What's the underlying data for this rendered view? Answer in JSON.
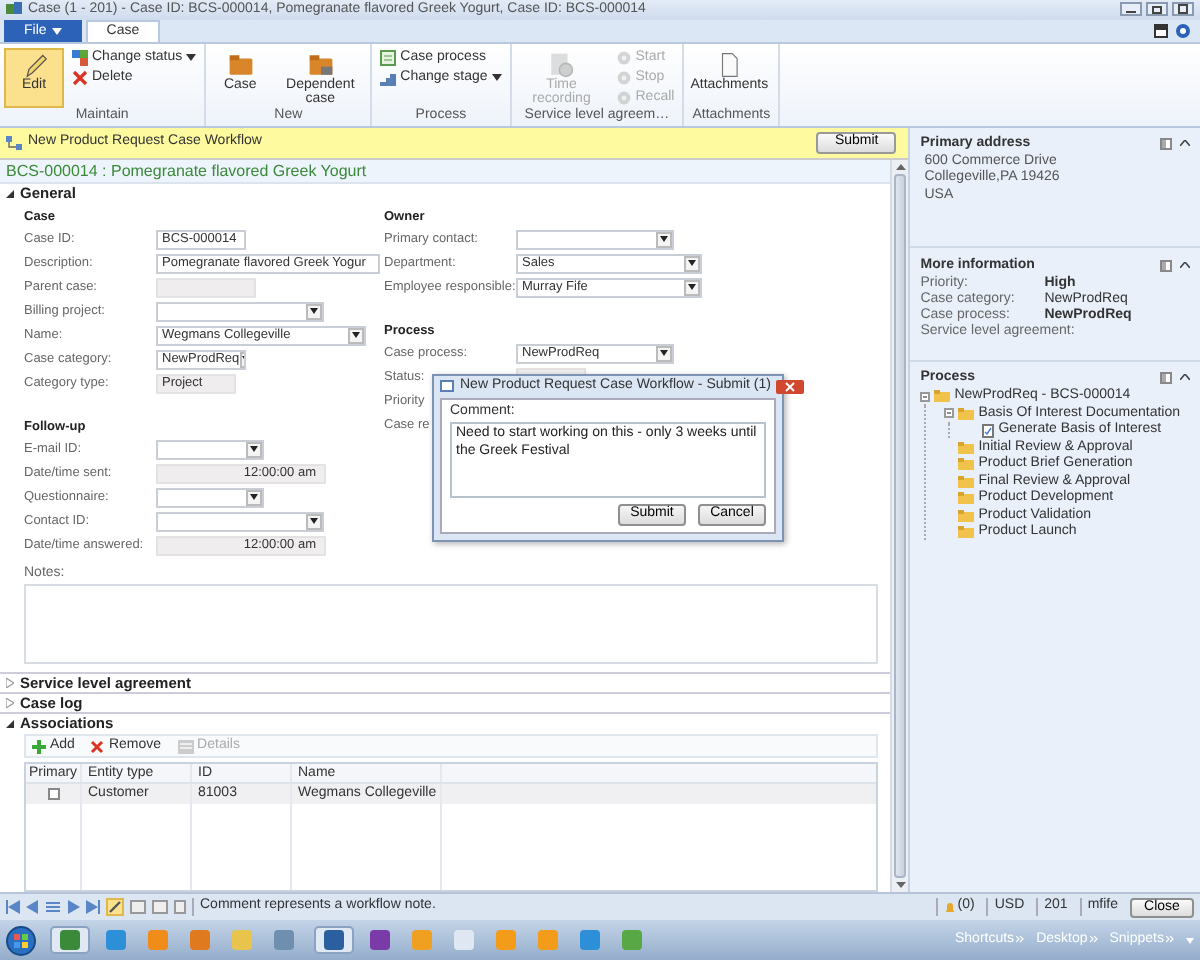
{
  "window": {
    "title": "Case (1 - 201) - Case ID: BCS-000014, Pomegranate flavored Greek Yogurt, Case ID: BCS-000014"
  },
  "tabs": [
    {
      "label": "File",
      "kind": "menu",
      "selected": false
    },
    {
      "label": "Case",
      "kind": "tab",
      "selected": true
    }
  ],
  "ribbon": [
    {
      "label": "Maintain",
      "buttons": [
        {
          "label": "Edit",
          "kind": "large",
          "selected": true,
          "disabled": false,
          "dropdown": false
        },
        {
          "label": "Change status",
          "kind": "small",
          "selected": false,
          "disabled": false,
          "dropdown": true
        },
        {
          "label": "Delete",
          "kind": "small",
          "selected": false,
          "disabled": false,
          "dropdown": false
        }
      ]
    },
    {
      "label": "New",
      "buttons": [
        {
          "label": "Case",
          "kind": "large",
          "selected": false,
          "disabled": false,
          "dropdown": false
        },
        {
          "label": "Dependent case",
          "kind": "large",
          "selected": false,
          "disabled": false,
          "dropdown": false
        }
      ]
    },
    {
      "label": "Process",
      "buttons": [
        {
          "label": "Case process",
          "kind": "small",
          "selected": false,
          "disabled": false,
          "dropdown": false
        },
        {
          "label": "Change stage",
          "kind": "small",
          "selected": false,
          "disabled": false,
          "dropdown": true
        }
      ]
    },
    {
      "label": "Service level agreem…",
      "buttons": [
        {
          "label": "Time recording",
          "kind": "large",
          "selected": false,
          "disabled": true,
          "dropdown": false
        },
        {
          "label": "Start",
          "kind": "small",
          "selected": false,
          "disabled": true,
          "dropdown": false
        },
        {
          "label": "Stop",
          "kind": "small",
          "selected": false,
          "disabled": true,
          "dropdown": false
        },
        {
          "label": "Recall",
          "kind": "small",
          "selected": false,
          "disabled": true,
          "dropdown": false
        }
      ]
    },
    {
      "label": "Attachments",
      "buttons": [
        {
          "label": "Attachments",
          "kind": "large",
          "selected": false,
          "disabled": false,
          "dropdown": false
        }
      ]
    }
  ],
  "workflow": {
    "title": "New Product Request Case Workflow",
    "button": "Submit"
  },
  "record_title": "BCS-000014 : Pomegranate flavored Greek Yogurt",
  "sections": [
    {
      "title": "General",
      "expanded": true,
      "columns": [
        [
          {
            "heading": "Case",
            "fields": [
              {
                "label": "Case ID:",
                "kind": "text",
                "value": "BCS-000014"
              },
              {
                "label": "Description:",
                "kind": "text",
                "value": "Pomegranate flavored Greek Yogur"
              },
              {
                "label": "Parent case:",
                "kind": "readonly"
              },
              {
                "label": "Billing project:",
                "kind": "dropdown"
              },
              {
                "label": "Name:",
                "kind": "dropdown",
                "value": "Wegmans Collegeville"
              },
              {
                "label": "Case category:",
                "kind": "dropdown",
                "value": "NewProdReq"
              },
              {
                "label": "Category type:",
                "kind": "readonly",
                "value": "Project"
              }
            ]
          },
          {
            "heading": "Follow-up",
            "fields": [
              {
                "label": "E-mail ID:",
                "kind": "dropdown"
              },
              {
                "label": "Date/time sent:",
                "kind": "datetime",
                "value": "12:00:00 am"
              },
              {
                "label": "Questionnaire:",
                "kind": "dropdown"
              },
              {
                "label": "Contact ID:",
                "kind": "dropdown"
              },
              {
                "label": "Date/time answered:",
                "kind": "datetime",
                "value": "12:00:00 am"
              }
            ]
          }
        ],
        [
          {
            "heading": "Owner",
            "fields": [
              {
                "label": "Primary contact:",
                "kind": "dropdown"
              },
              {
                "label": "Department:",
                "kind": "dropdown",
                "value": "Sales"
              },
              {
                "label": "Employee responsible:",
                "kind": "dropdown",
                "value": "Murray Fife"
              }
            ]
          },
          {
            "heading": "Process",
            "fields": [
              {
                "label": "Case process:",
                "kind": "dropdown",
                "value": "NewProdReq"
              },
              {
                "label": "Status:",
                "kind": "readonly"
              },
              {
                "label": "Priority",
                "kind": "hidden"
              },
              {
                "label": "Case re",
                "kind": "hidden"
              }
            ]
          }
        ]
      ],
      "notes": "Notes:"
    },
    {
      "title": "Service level agreement",
      "expanded": false
    },
    {
      "title": "Case log",
      "expanded": false
    },
    {
      "title": "Associations",
      "expanded": true,
      "toolbar": [
        {
          "label": "Add",
          "disabled": false
        },
        {
          "label": "Remove",
          "disabled": false
        },
        {
          "label": "Details",
          "disabled": true
        }
      ],
      "table": {
        "columns": [
          "Primary",
          "Entity type",
          "ID",
          "Name"
        ],
        "rows": [
          {
            "cells": [
              {
                "kind": "checkbox",
                "checked": false
              },
              "Customer",
              "81003",
              "Wegmans Collegeville"
            ]
          }
        ]
      }
    }
  ],
  "dialog": {
    "title": "New Product Request Case Workflow - Submit (1)",
    "label": "Comment:",
    "value": "Need to start working on this - only 3 weeks until the Greek Festival",
    "buttons": [
      "Submit",
      "Cancel"
    ]
  },
  "side_panels": [
    {
      "title": "Primary address",
      "kind": "address",
      "lines": [
        "600 Commerce Drive",
        "Collegeville,PA 19426",
        "USA"
      ]
    },
    {
      "title": "More information",
      "kind": "info",
      "rows": [
        {
          "label": "Priority:",
          "value": "High",
          "emphasis": true
        },
        {
          "label": "Case category:",
          "value": "NewProdReq",
          "emphasis": false
        },
        {
          "label": "Case process:",
          "value": "NewProdReq",
          "emphasis": true
        },
        {
          "label": "Service level agreement:"
        }
      ]
    },
    {
      "title": "Process",
      "kind": "tree",
      "tree": [
        {
          "label": "NewProdReq - BCS-000014",
          "kind": "folder",
          "expanded": true,
          "children": [
            {
              "label": "Basis Of Interest Documentation",
              "kind": "folder",
              "expanded": true,
              "children": [
                {
                  "label": "Generate Basis of Interest",
                  "kind": "task"
                }
              ]
            },
            {
              "label": "Initial Review & Approval",
              "kind": "folder"
            },
            {
              "label": "Product Brief Generation",
              "kind": "folder"
            },
            {
              "label": "Final Review & Approval",
              "kind": "folder"
            },
            {
              "label": "Product Development",
              "kind": "folder"
            },
            {
              "label": "Product Validation",
              "kind": "folder"
            },
            {
              "label": "Product Launch",
              "kind": "folder"
            }
          ]
        }
      ]
    }
  ],
  "status_bar": {
    "message": "Comment represents a workflow note.",
    "alerts": "(0)",
    "currency": "USD",
    "company": "201",
    "user": "mfife",
    "button": "Close"
  },
  "taskbar": {
    "tray": [
      "Shortcuts",
      "Desktop",
      "Snippets"
    ]
  }
}
